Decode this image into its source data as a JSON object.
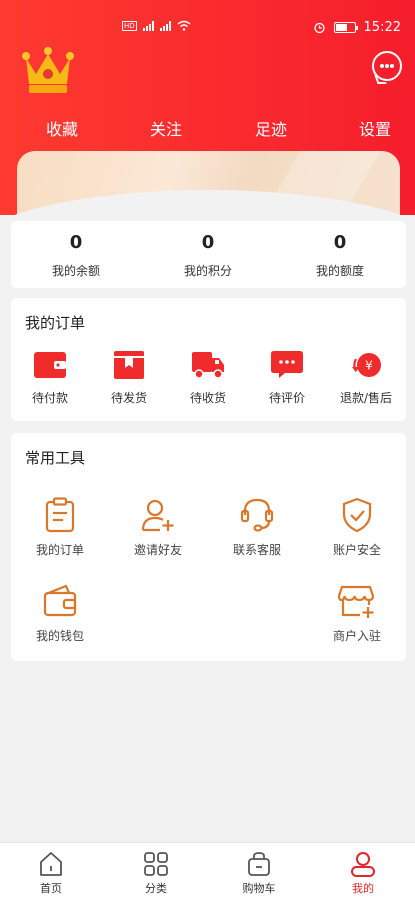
{
  "status_bar": {
    "time": "15:22"
  },
  "quick_nav": [
    {
      "label": "收藏"
    },
    {
      "label": "关注"
    },
    {
      "label": "足迹"
    },
    {
      "label": "设置"
    }
  ],
  "stats": [
    {
      "value": "0",
      "label": "我的余额"
    },
    {
      "value": "0",
      "label": "我的积分"
    },
    {
      "value": "0",
      "label": "我的额度"
    }
  ],
  "orders": {
    "title": "我的订单",
    "items": [
      {
        "label": "待付款",
        "icon": "wallet-icon"
      },
      {
        "label": "待发货",
        "icon": "package-icon"
      },
      {
        "label": "待收货",
        "icon": "truck-icon"
      },
      {
        "label": "待评价",
        "icon": "comment-icon"
      },
      {
        "label": "退款/售后",
        "icon": "refund-icon"
      }
    ]
  },
  "tools": {
    "title": "常用工具",
    "items": [
      {
        "label": "我的订单",
        "icon": "clipboard-icon"
      },
      {
        "label": "邀请好友",
        "icon": "add-user-icon"
      },
      {
        "label": "联系客服",
        "icon": "headset-icon"
      },
      {
        "label": "账户安全",
        "icon": "shield-check-icon"
      },
      {
        "label": "我的钱包",
        "icon": "wallet-icon"
      },
      {
        "label": "商户入驻",
        "icon": "shop-icon"
      }
    ]
  },
  "tabbar": [
    {
      "label": "首页",
      "icon": "home-icon",
      "active": false
    },
    {
      "label": "分类",
      "icon": "grid-icon",
      "active": false
    },
    {
      "label": "购物车",
      "icon": "cart-bag-icon",
      "active": false
    },
    {
      "label": "我的",
      "icon": "user-icon",
      "active": true
    }
  ],
  "colors": {
    "brand_red": "#f51e2c",
    "tool_orange": "#d9782a",
    "active_tab": "#e4252c"
  }
}
